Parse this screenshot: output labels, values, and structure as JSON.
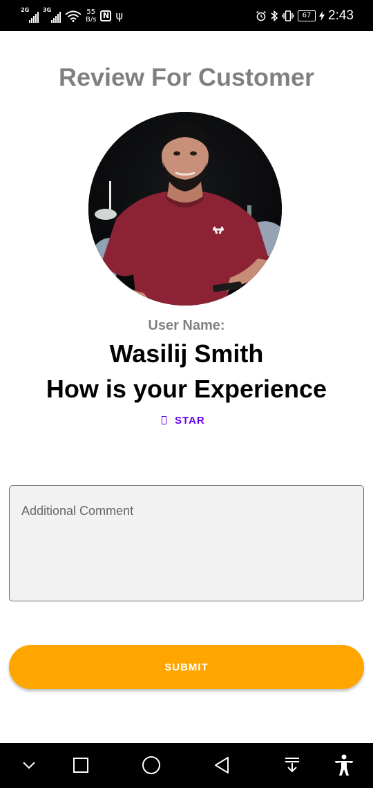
{
  "status_bar": {
    "sim1_network": "2G",
    "sim2_network": "3G",
    "net_speed_value": "55",
    "net_speed_unit": "B/s",
    "nfc_label": "N",
    "battery_level": "67",
    "time": "2:43",
    "icons": [
      "signal-icon",
      "wifi-icon",
      "nfc-icon",
      "usb-icon",
      "alarm-icon",
      "bluetooth-icon",
      "vibrate-icon",
      "battery-icon",
      "charging-icon"
    ]
  },
  "page": {
    "title": "Review For Customer",
    "user_label": "User Name:",
    "user_name": "Wasilij Smith",
    "experience_prompt": "How is your Experience",
    "star_label": "STAR"
  },
  "comment": {
    "placeholder": "Additional Comment",
    "value": ""
  },
  "submit": {
    "label": "SUBMIT"
  },
  "nav_bar": {
    "icons": [
      "chevron-down-icon",
      "recents-icon",
      "home-icon",
      "back-icon",
      "notification-pull-icon",
      "accessibility-icon"
    ]
  },
  "colors": {
    "title_gray": "#808080",
    "accent_purple": "#6200ee",
    "submit_orange": "#ffa500",
    "input_background": "#f2f2f2",
    "bars_black": "#000000"
  }
}
